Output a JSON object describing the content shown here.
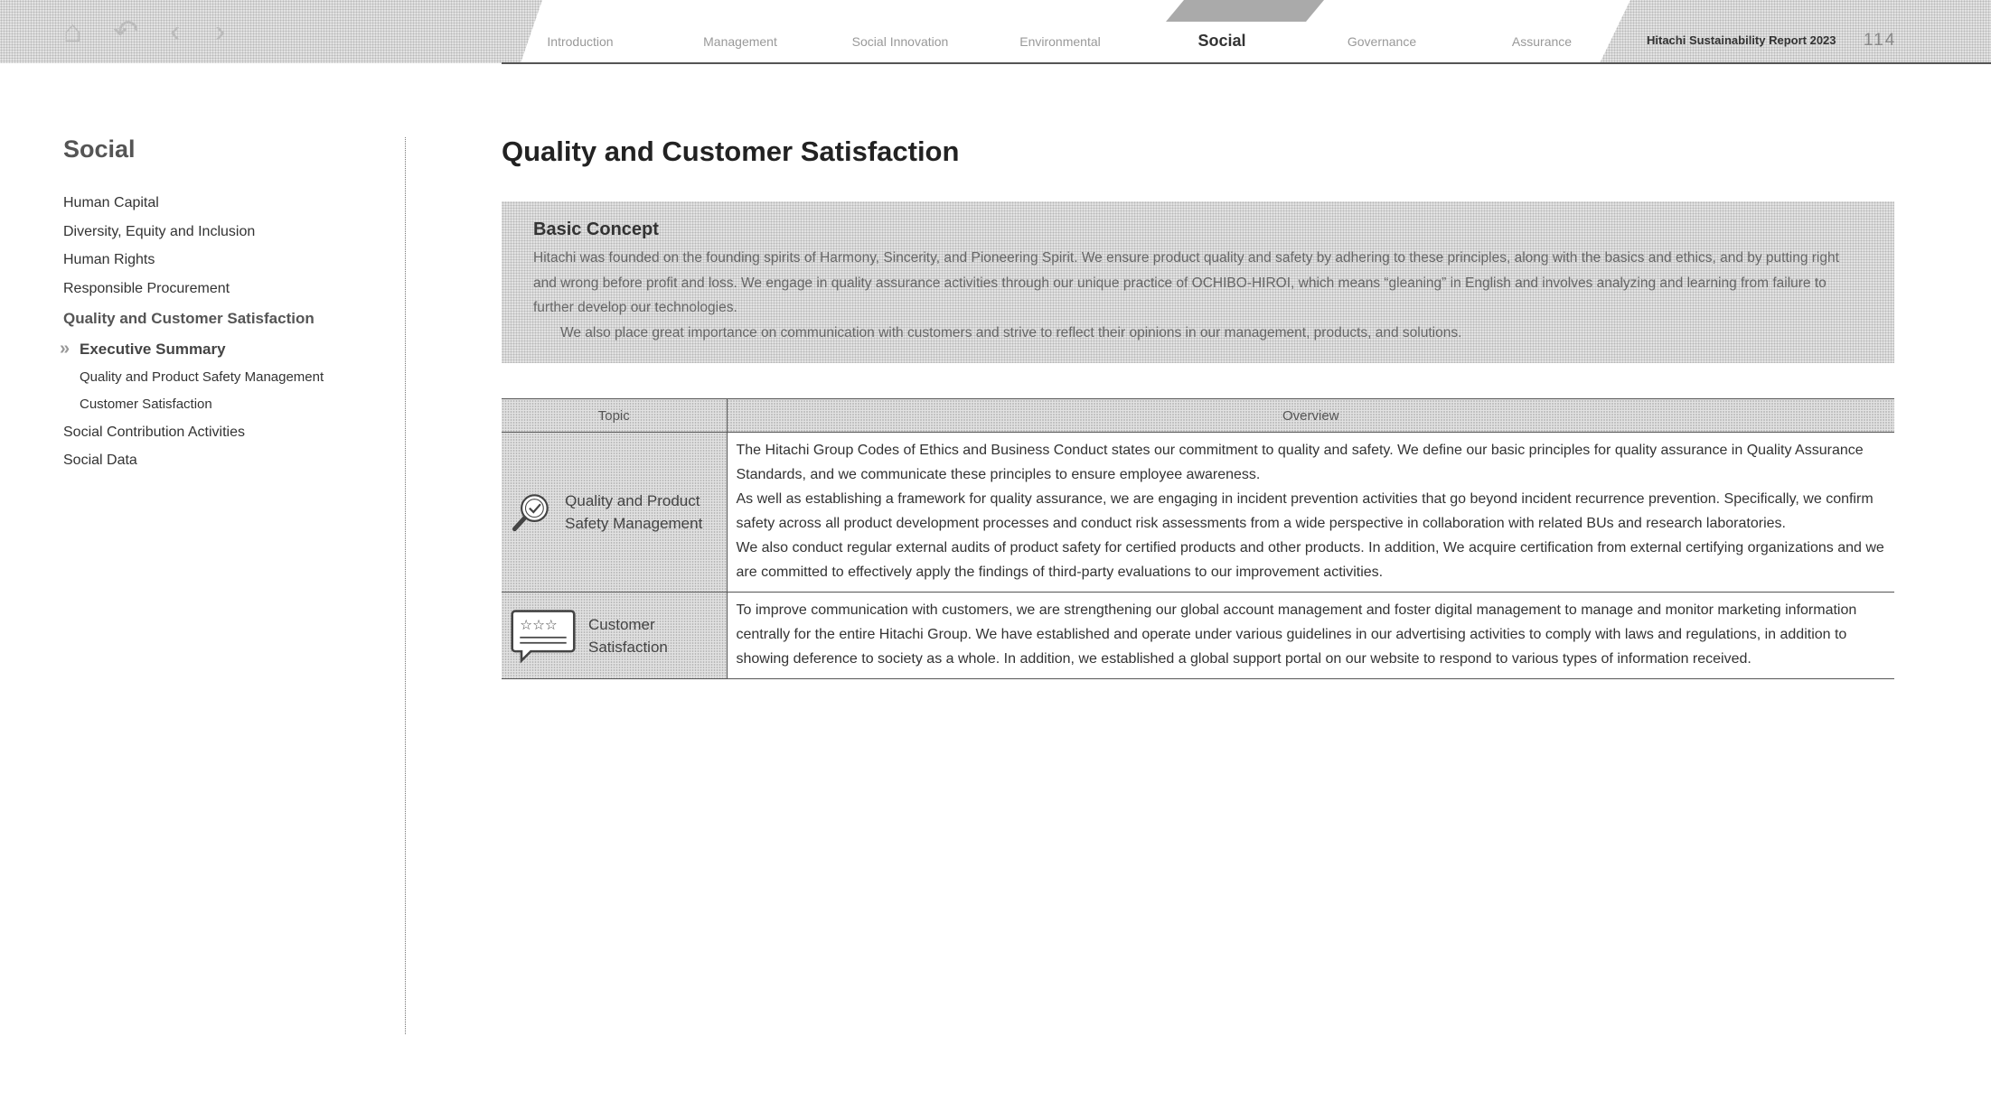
{
  "header": {
    "nav_icons": [
      "home-icon",
      "undo-icon",
      "previous-icon",
      "next-icon"
    ],
    "tabs": [
      {
        "label": "Introduction"
      },
      {
        "label": "Management"
      },
      {
        "label": "Social Innovation"
      },
      {
        "label": "Environmental"
      },
      {
        "label": "Social",
        "active": true
      },
      {
        "label": "Governance"
      },
      {
        "label": "Assurance"
      }
    ],
    "report_title": "Hitachi Sustainability Report 2023",
    "page_number": "114"
  },
  "sidebar": {
    "title": "Social",
    "items": [
      "Human Capital",
      "Diversity, Equity and Inclusion",
      "Human Rights",
      "Responsible Procurement",
      "Quality and Customer Satisfaction",
      "Executive Summary",
      "Quality and Product Safety Management",
      "Customer Satisfaction",
      "Social Contribution Activities",
      "Social Data"
    ]
  },
  "main": {
    "title": "Quality and Customer Satisfaction",
    "concept": {
      "heading": "Basic Concept",
      "p1": "Hitachi was founded on the founding spirits of Harmony, Sincerity, and Pioneering Spirit. We ensure product quality and safety by adhering to these principles, along with the basics and ethics, and by putting right and wrong before profit and loss. We engage in quality assurance activities through our unique practice of OCHIBO-HIROI, which means “gleaning” in English and involves analyzing and learning from failure to further develop our technologies.",
      "p2": "We also place great importance on communication with customers and strive to reflect their opinions in our management, products, and solutions."
    },
    "table": {
      "headers": [
        "Topic",
        "Overview"
      ],
      "rows": [
        {
          "icon": "magnifier-check-icon",
          "topic": "Quality and Product Safety Management",
          "lines": [
            "The Hitachi Group Codes of Ethics and Business Conduct states our commitment to quality and safety. We define our basic principles for quality assurance in Quality Assurance Standards, and we communicate these principles to ensure employee awareness.",
            "As well as establishing a framework for quality assurance, we are engaging in incident prevention activities that go beyond incident recurrence prevention. Specifically, we confirm safety across all product development processes and conduct risk assessments from a wide perspective in collaboration with related BUs and research laboratories.",
            "We also conduct regular external audits of product safety for certified products and other products. In addition, We acquire certification from external certifying organizations and we are committed to effectively apply the findings of third-party evaluations to our improvement activities."
          ]
        },
        {
          "icon": "star-rating-speech-icon",
          "topic": "Customer Satisfaction",
          "lines": [
            "To improve communication with customers, we are strengthening our global account management and foster digital management to manage and monitor marketing information centrally for the entire Hitachi Group. We have established and operate under various guidelines in our advertising activities to comply with laws and regulations, in addition to showing deference to society as a whole. In addition, we established a global support portal on our website to respond to various types of information received."
          ]
        }
      ]
    }
  }
}
